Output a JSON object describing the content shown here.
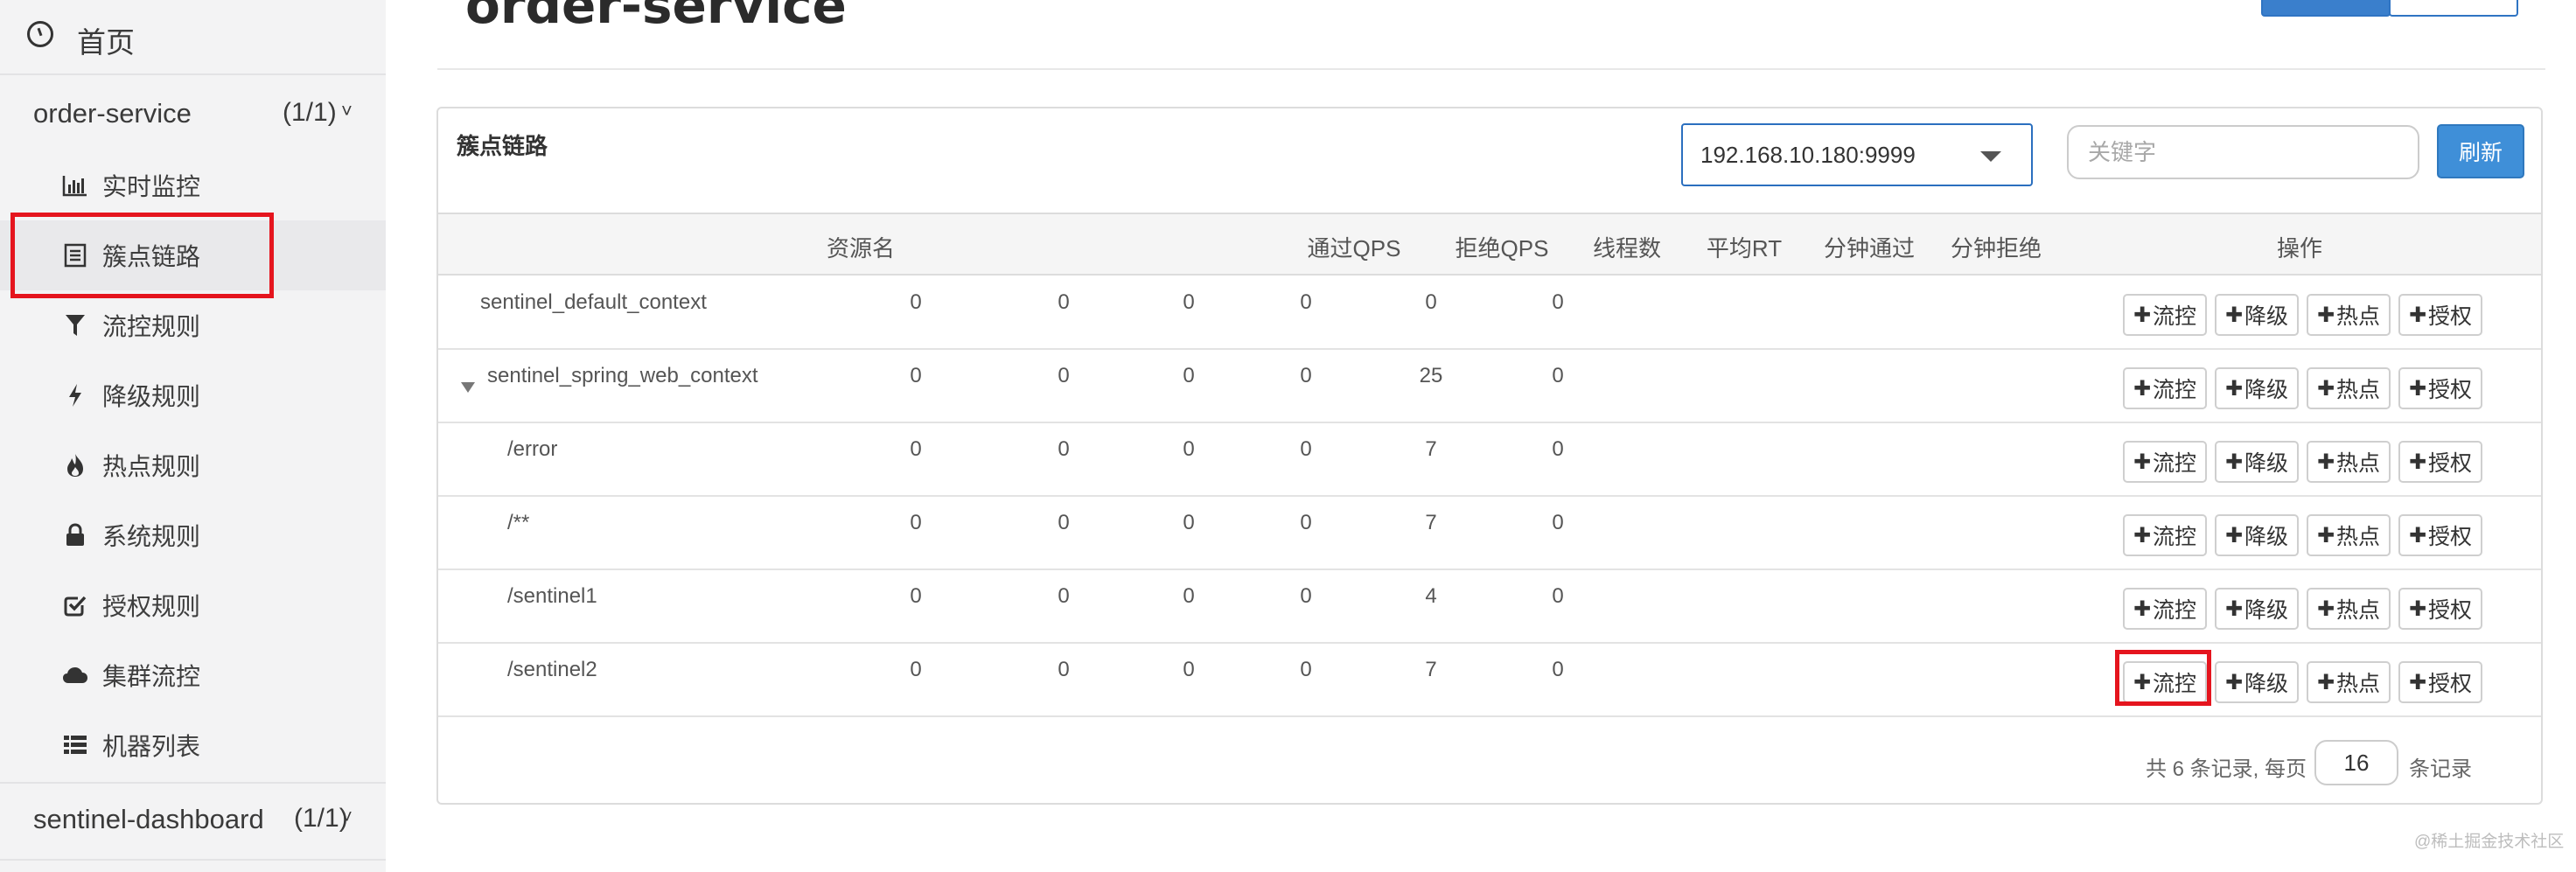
{
  "sidebar": {
    "home_label": "首页",
    "app": {
      "name": "order-service",
      "count": "(1/1)"
    },
    "items": [
      {
        "label": "实时监控",
        "icon": "bar-chart-icon"
      },
      {
        "label": "簇点链路",
        "icon": "list-doc-icon"
      },
      {
        "label": "流控规则",
        "icon": "filter-icon"
      },
      {
        "label": "降级规则",
        "icon": "bolt-icon"
      },
      {
        "label": "热点规则",
        "icon": "fire-icon"
      },
      {
        "label": "系统规则",
        "icon": "lock-icon"
      },
      {
        "label": "授权规则",
        "icon": "check-square-icon"
      },
      {
        "label": "集群流控",
        "icon": "cloud-icon"
      },
      {
        "label": "机器列表",
        "icon": "list-icon"
      }
    ],
    "app2": {
      "name": "sentinel-dashboard",
      "count": "(1/1)"
    }
  },
  "main": {
    "title": "order-service"
  },
  "panel": {
    "title": "簇点链路",
    "machine_select": "192.168.10.180:9999",
    "search_placeholder": "关键字",
    "refresh_label": "刷新"
  },
  "table": {
    "columns": [
      "资源名",
      "通过QPS",
      "拒绝QPS",
      "线程数",
      "平均RT",
      "分钟通过",
      "分钟拒绝",
      "操作"
    ],
    "rows": [
      {
        "name": "sentinel_default_context",
        "pass_qps": "0",
        "block_qps": "0",
        "threads": "0",
        "avg_rt": "0",
        "min_pass": "0",
        "min_block": "0"
      },
      {
        "name": "sentinel_spring_web_context",
        "pass_qps": "0",
        "block_qps": "0",
        "threads": "0",
        "avg_rt": "0",
        "min_pass": "25",
        "min_block": "0"
      },
      {
        "name": "/error",
        "pass_qps": "0",
        "block_qps": "0",
        "threads": "0",
        "avg_rt": "0",
        "min_pass": "7",
        "min_block": "0"
      },
      {
        "name": "/**",
        "pass_qps": "0",
        "block_qps": "0",
        "threads": "0",
        "avg_rt": "0",
        "min_pass": "7",
        "min_block": "0"
      },
      {
        "name": "/sentinel1",
        "pass_qps": "0",
        "block_qps": "0",
        "threads": "0",
        "avg_rt": "0",
        "min_pass": "4",
        "min_block": "0"
      },
      {
        "name": "/sentinel2",
        "pass_qps": "0",
        "block_qps": "0",
        "threads": "0",
        "avg_rt": "0",
        "min_pass": "7",
        "min_block": "0"
      }
    ],
    "actions": {
      "flow": "流控",
      "degrade": "降级",
      "hot": "热点",
      "auth": "授权"
    }
  },
  "footer": {
    "prefix": "共 6 条记录, 每页",
    "page_size": "16",
    "suffix": "条记录"
  },
  "watermark": "@稀土掘金技术社区",
  "colors": {
    "highlight": "#e5151e",
    "primary": "#3f8fd8",
    "sidebar_bg": "#f3f3f4"
  }
}
